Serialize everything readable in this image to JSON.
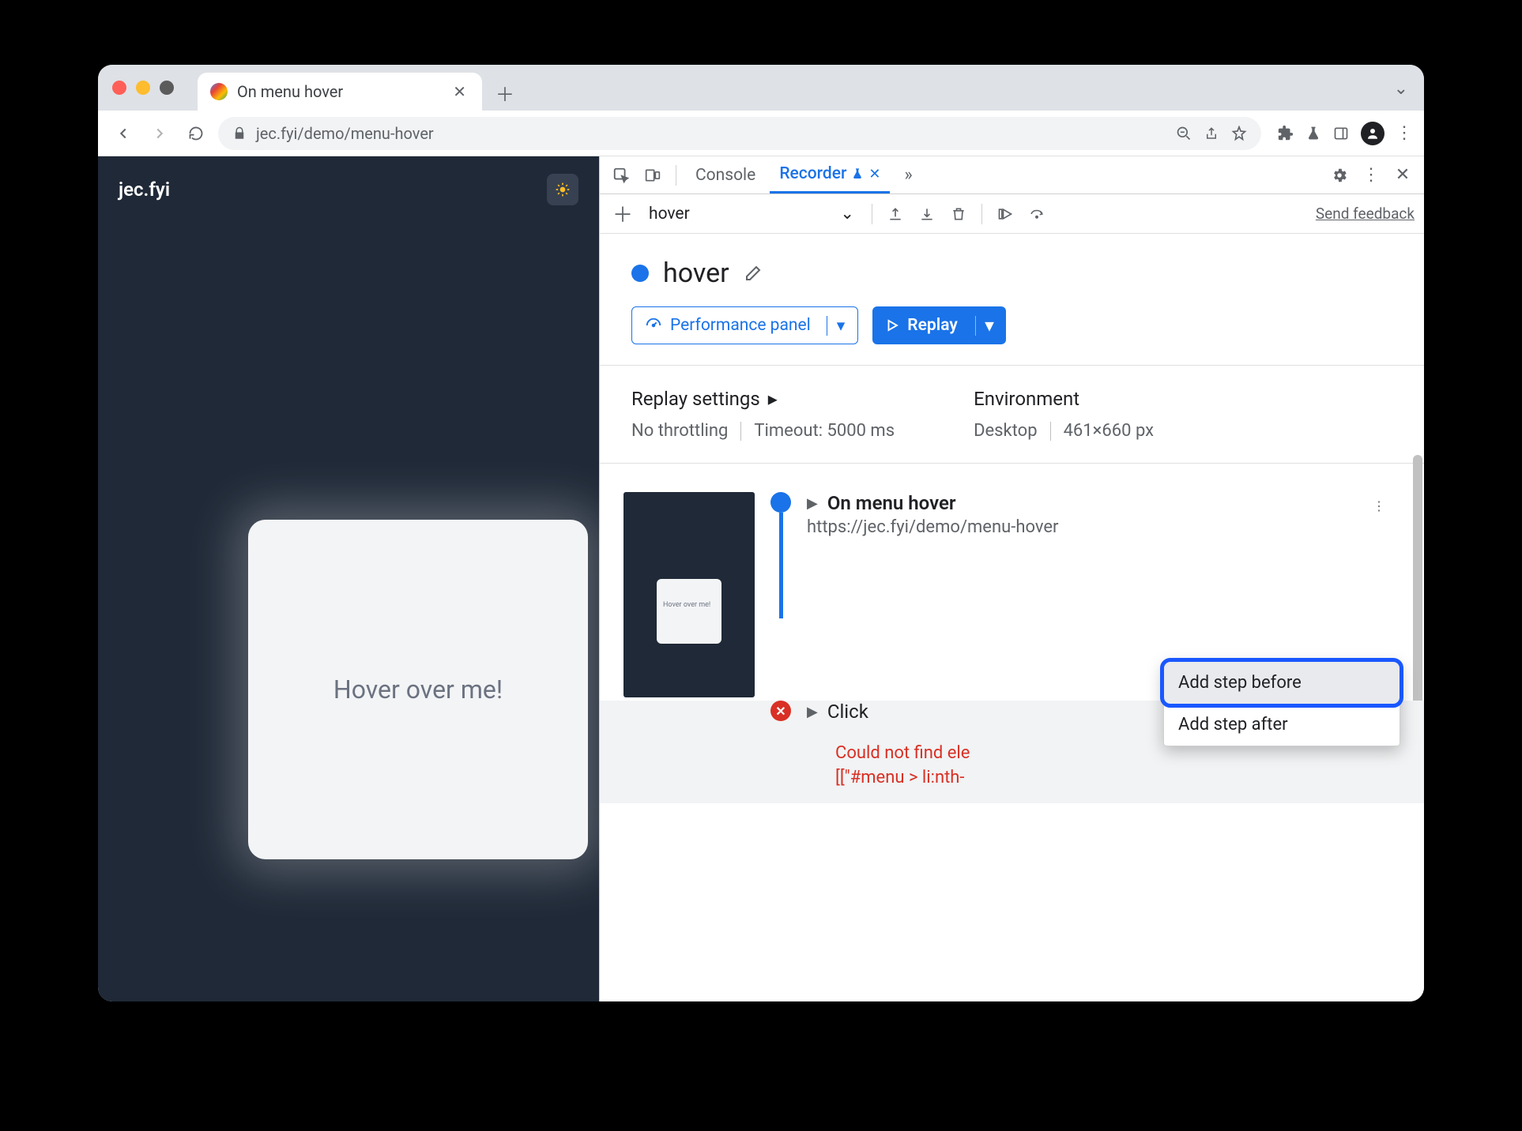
{
  "browser": {
    "tab_title": "On menu hover",
    "url": "jec.fyi/demo/menu-hover"
  },
  "page": {
    "site_title": "jec.fyi",
    "card_text": "Hover over me!"
  },
  "devtools": {
    "tabs": {
      "console": "Console",
      "recorder": "Recorder"
    },
    "recorder": {
      "select_value": "hover",
      "feedback": "Send feedback",
      "title": "hover",
      "perf_btn": "Performance panel",
      "replay_btn": "Replay",
      "settings": {
        "replay_label": "Replay settings",
        "throttling": "No throttling",
        "timeout": "Timeout: 5000 ms",
        "env_label": "Environment",
        "device": "Desktop",
        "viewport": "461×660 px"
      },
      "steps": {
        "s1_title": "On menu hover",
        "s1_url": "https://jec.fyi/demo/menu-hover",
        "s2_title": "Click",
        "error_l1": "Could not find ele",
        "error_l2": "[[\"#menu > li:nth-"
      },
      "ctx": {
        "before": "Add step before",
        "after": "Add step after"
      }
    }
  },
  "thumb_text": "Hover over me!"
}
